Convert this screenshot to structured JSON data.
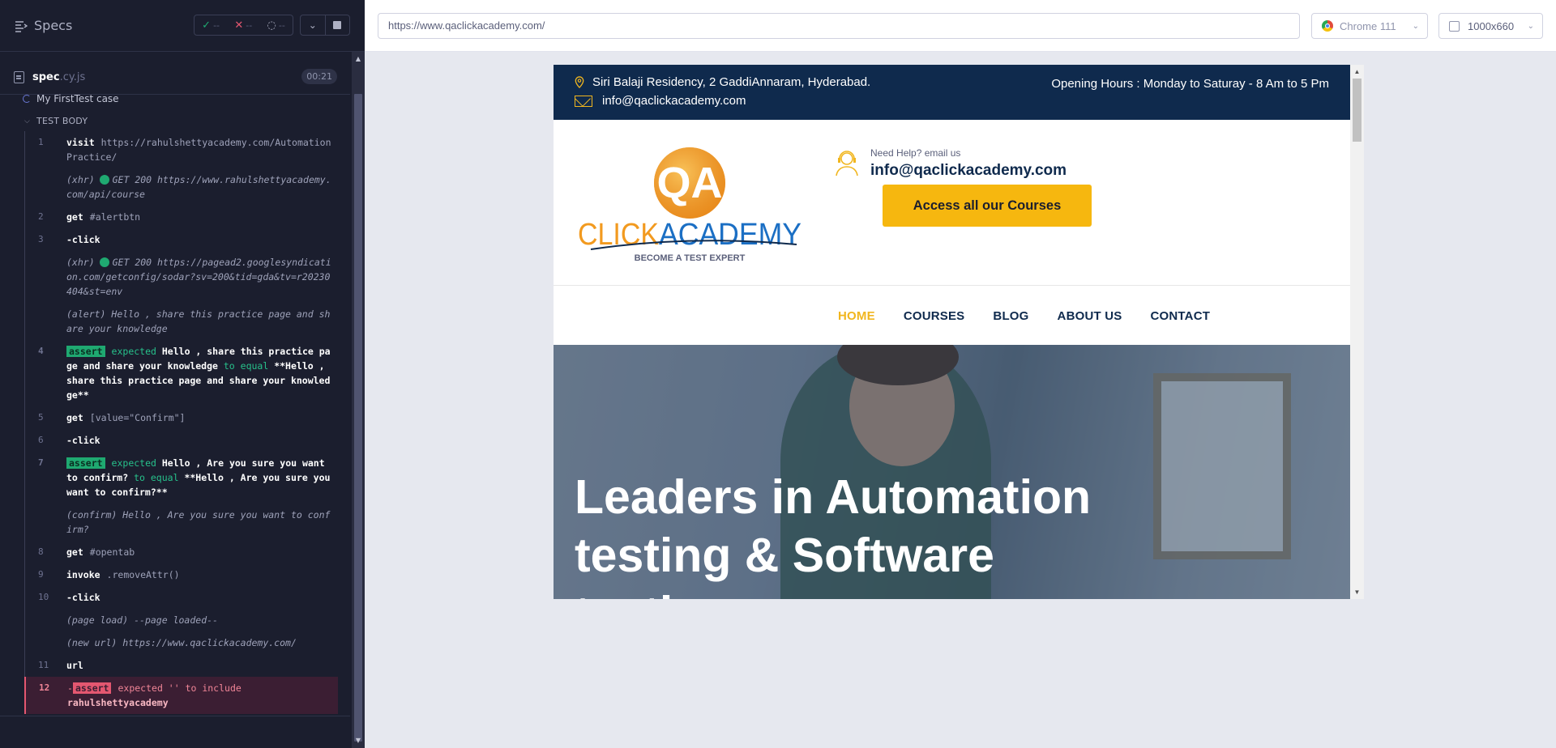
{
  "reporter": {
    "specs_label": "Specs",
    "stats": {
      "passed": "--",
      "failed": "--",
      "pending": "--"
    },
    "spec_file": {
      "name": "spec",
      "ext": ".cy.js",
      "duration": "00:21"
    },
    "test_title": "My FirstTest case",
    "section_label": "TEST BODY",
    "commands": [
      {
        "num": "1",
        "name": "visit",
        "msg": "https://rahulshettyacademy.com/AutomationPractice/"
      },
      {
        "event": "(xhr)",
        "msg": "GET 200 https://www.rahulshettyacademy.com/api/course"
      },
      {
        "num": "2",
        "name": "get",
        "msg": "#alertbtn"
      },
      {
        "num": "3",
        "name": "-click",
        "msg": ""
      },
      {
        "event": "(xhr)",
        "msg": "GET 200 https://pagead2.googlesyndication.com/getconfig/sodar?sv=200&tid=gda&tv=r20230404&st=env"
      },
      {
        "event": "(alert)",
        "msg": "Hello , share this practice page and share your knowledge"
      },
      {
        "num": "4",
        "tag": "assert",
        "expected": "expected",
        "value": "Hello , share this practice page and share your knowledge",
        "to": "to equal",
        "value2": "**Hello , share this practice page and share your knowledge**"
      },
      {
        "num": "5",
        "name": "get",
        "msg": "[value=\"Confirm\"]"
      },
      {
        "num": "6",
        "name": "-click",
        "msg": ""
      },
      {
        "num": "7",
        "tag": "assert",
        "expected": "expected",
        "value": "Hello , Are you sure you want to confirm?",
        "to": "to equal",
        "value2": "**Hello , Are you sure you want to confirm?**"
      },
      {
        "event": "(confirm)",
        "msg": "Hello , Are you sure you want to confirm?"
      },
      {
        "num": "8",
        "name": "get",
        "msg": "#opentab"
      },
      {
        "num": "9",
        "name": "invoke",
        "msg": ".removeAttr()"
      },
      {
        "num": "10",
        "name": "-click",
        "msg": ""
      },
      {
        "event": "(page load)",
        "msg": "--page loaded--"
      },
      {
        "event": "(new url)",
        "msg": "https://www.qaclickacademy.com/"
      },
      {
        "num": "11",
        "name": "url",
        "msg": ""
      },
      {
        "num": "12",
        "tag": "assert",
        "expected": "expected '' to include",
        "value": "rahulshettyacademy"
      }
    ]
  },
  "url_bar": {
    "url": "https://www.qaclickacademy.com/",
    "browser": "Chrome 111",
    "viewport": "1000x660"
  },
  "site": {
    "address": "Siri Balaji Residency, 2 GaddiAnnaram, Hyderabad.",
    "email": "info@qaclickacademy.com",
    "hours": "Opening Hours : Monday to Saturay - 8 Am to 5 Pm",
    "logo_text_1": "CLICK",
    "logo_text_2": "ACADEMY",
    "logo_badge": "QA",
    "logo_tagline": "BECOME A TEST EXPERT",
    "help_label": "Need Help? email us",
    "help_email": "info@qaclickacademy.com",
    "courses_button": "Access all our Courses",
    "nav": [
      "HOME",
      "COURSES",
      "BLOG",
      "ABOUT US",
      "CONTACT"
    ],
    "hero_title": "Leaders in Automation testing & Software testing"
  },
  "colors": {
    "reporter_bg": "#1b1e2e",
    "pass": "#1fa971",
    "fail": "#e45770",
    "site_navy": "#0f2a4d",
    "site_accent": "#f6b70f"
  }
}
